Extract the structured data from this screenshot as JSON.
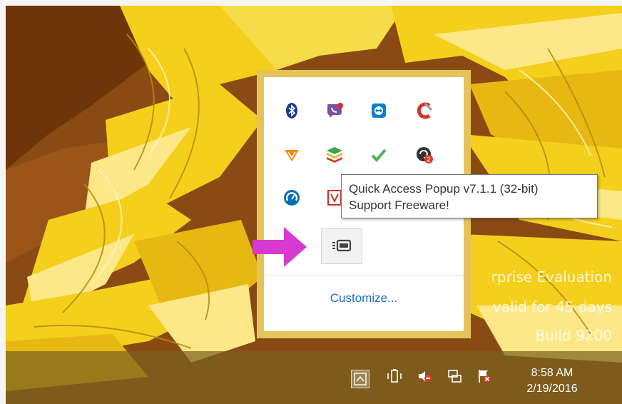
{
  "wallpaper": {
    "colors": {
      "sky": "#8a4a14",
      "hair": "#f4cf1c",
      "hair_light": "#fde889",
      "hair_shadow": "#b98a0a"
    }
  },
  "watermark": {
    "line1": "rprise Evaluation",
    "line2": "valid for 45 days",
    "line3": "Build 9200"
  },
  "tray_popup": {
    "icons": [
      {
        "name": "bluetooth-icon",
        "color": "#1a3a8a"
      },
      {
        "name": "viber-icon",
        "color": "#7b519d"
      },
      {
        "name": "teamviewer-icon",
        "color": "#0e7ed1"
      },
      {
        "name": "ccleaner-icon",
        "color": "#d2352a"
      },
      {
        "name": "wps-office-icon",
        "color": "#f28c15"
      },
      {
        "name": "bluestacks-icon",
        "color": "#3aa84a"
      },
      {
        "name": "check-icon",
        "color": "#4bb34b"
      },
      {
        "name": "update-icon",
        "color": "#333333"
      },
      {
        "name": "speedtest-icon",
        "color": "#0a6db5"
      },
      {
        "name": "pdf-icon",
        "color": "#c9332c"
      },
      {
        "name": "orange-app-icon",
        "color": "#f28c15"
      },
      {
        "name": "quick-access-popup-icon",
        "color": "#444444"
      }
    ],
    "customize_label": "Customize..."
  },
  "tooltip": {
    "line1": "Quick Access Popup v7.1.1 (32-bit)",
    "line2": "Support Freeware!"
  },
  "arrow": {
    "color": "#d63ad0"
  },
  "taskbar": {
    "tray_icons": [
      "show-hidden-icons",
      "power-icon",
      "volume-muted-icon",
      "network-icon",
      "action-center-flag-icon"
    ],
    "clock": {
      "time": "8:58 AM",
      "date": "2/19/2016"
    }
  }
}
